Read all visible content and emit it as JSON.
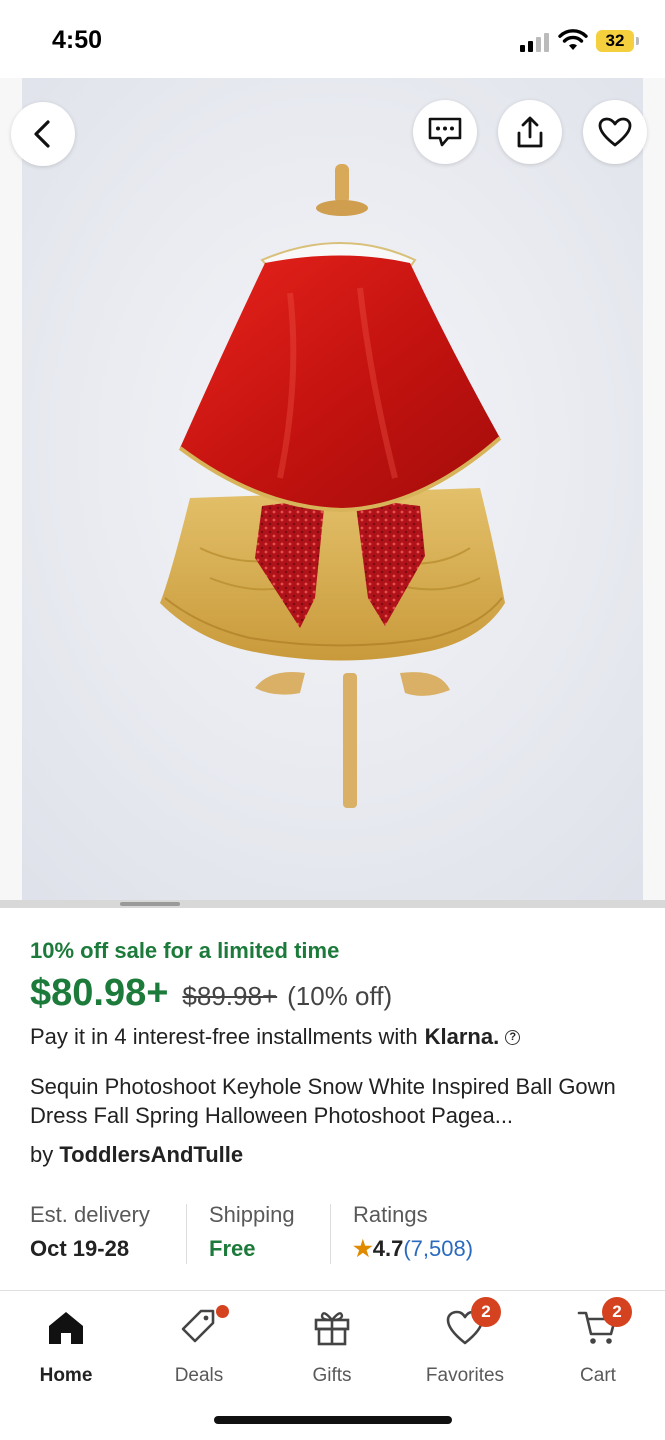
{
  "status_bar": {
    "time": "4:50",
    "battery": "32"
  },
  "product": {
    "sale_text": "10% off sale for a limited time",
    "price": "$80.98+",
    "original_price": "$89.98+",
    "discount": "(10% off)",
    "installments_text": "Pay it in 4 interest-free installments with",
    "klarna_label": "Klarna.",
    "title": "Sequin Photoshoot Keyhole Snow White Inspired Ball Gown Dress Fall Spring Halloween Photoshoot Pagea...",
    "seller_prefix": "by",
    "seller_name": "ToddlersAndTulle"
  },
  "details": {
    "delivery_label": "Est. delivery",
    "delivery_value": "Oct 19-28",
    "shipping_label": "Shipping",
    "shipping_value": "Free",
    "ratings_label": "Ratings",
    "rating_value": "4.7",
    "rating_count": "(7,508)"
  },
  "nav": {
    "home": "Home",
    "deals": "Deals",
    "gifts": "Gifts",
    "favorites": "Favorites",
    "favorites_badge": "2",
    "cart": "Cart",
    "cart_badge": "2"
  },
  "icons": {
    "back": "chevron-left-icon",
    "message": "message-icon",
    "share": "share-icon",
    "favorite": "heart-icon"
  },
  "colors": {
    "sale_green": "#1c7a3a",
    "badge_red": "#d5421f",
    "link_blue": "#2b6bbf",
    "star_orange": "#e08a00"
  }
}
